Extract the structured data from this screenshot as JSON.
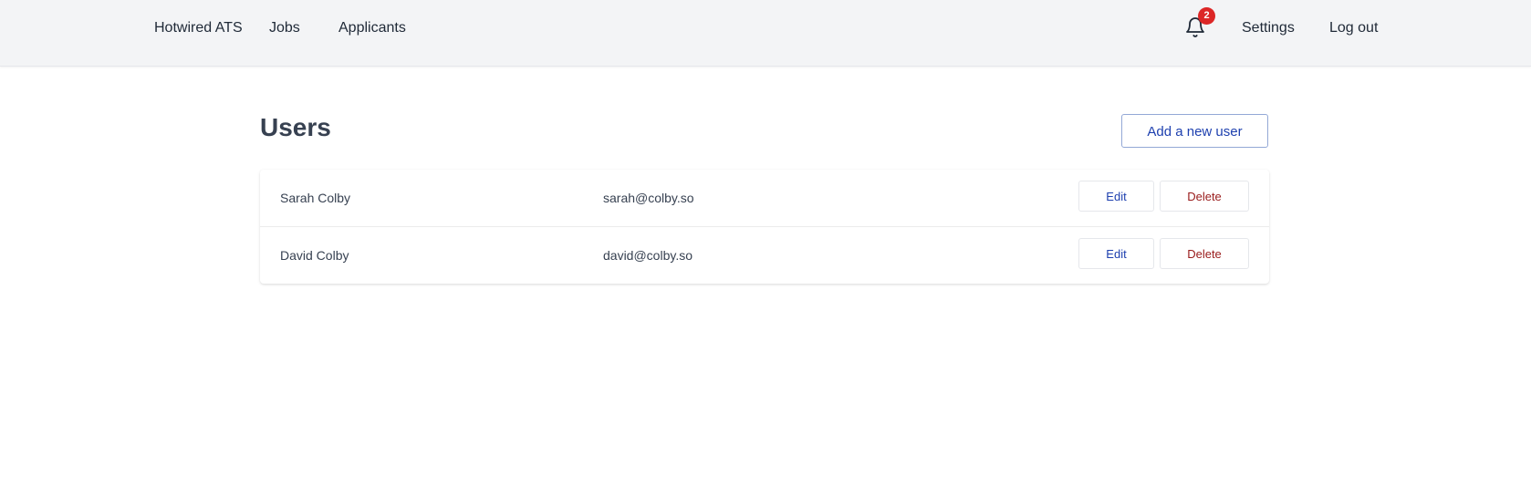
{
  "nav": {
    "brand": "Hotwired ATS",
    "jobs": "Jobs",
    "applicants": "Applicants",
    "settings": "Settings",
    "logout": "Log out",
    "notifications": {
      "icon": "bell-icon",
      "count": "2"
    }
  },
  "page": {
    "title": "Users",
    "add_button": "Add a new user"
  },
  "users": [
    {
      "name": "Sarah Colby",
      "email": "sarah@colby.so",
      "edit_label": "Edit",
      "delete_label": "Delete"
    },
    {
      "name": "David Colby",
      "email": "david@colby.so",
      "edit_label": "Edit",
      "delete_label": "Delete"
    }
  ],
  "colors": {
    "nav_background": "#f3f4f6",
    "accent_blue": "#1e40af",
    "danger_red": "#991b1b",
    "badge_red": "#dc2626"
  }
}
